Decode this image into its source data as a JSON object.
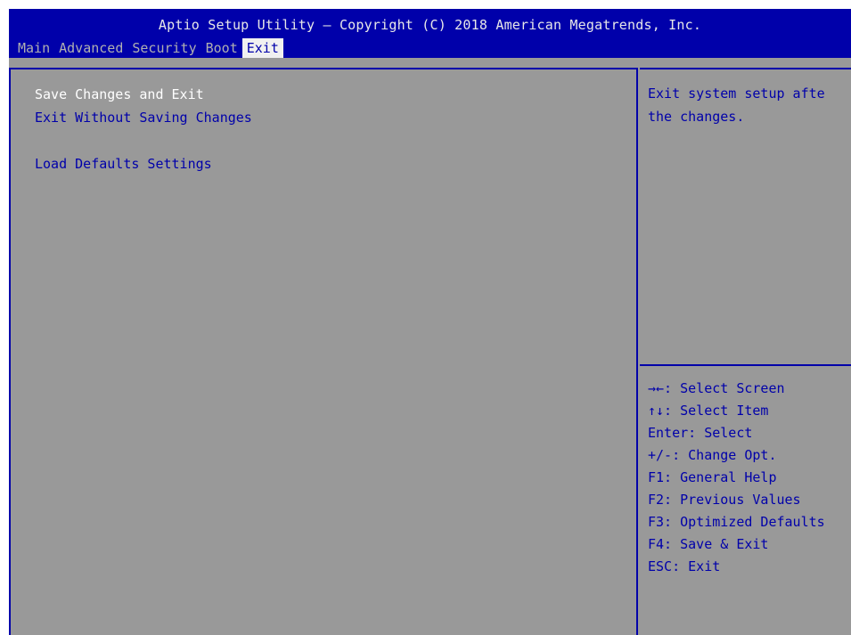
{
  "header": {
    "title": "Aptio Setup Utility – Copyright (C) 2018 American Megatrends, Inc.",
    "tabs": [
      {
        "label": "Main",
        "selected": false
      },
      {
        "label": "Advanced",
        "selected": false
      },
      {
        "label": "Security",
        "selected": false
      },
      {
        "label": "Boot",
        "selected": false
      },
      {
        "label": "Exit",
        "selected": true
      }
    ]
  },
  "menu": {
    "items": [
      {
        "label": "Save Changes and Exit",
        "selected": true
      },
      {
        "label": "Exit Without Saving Changes",
        "selected": false
      },
      {
        "label": "Load Defaults Settings",
        "selected": false
      }
    ]
  },
  "help": {
    "lines": [
      "Exit system setup afte",
      "the changes."
    ]
  },
  "keys": [
    "→←: Select Screen",
    "↑↓: Select Item",
    "Enter: Select",
    "+/-: Change Opt.",
    "F1: General Help",
    "F2: Previous Values",
    "F3: Optimized Defaults",
    "F4: Save & Exit",
    "ESC: Exit"
  ],
  "colors": {
    "header_bg": "#0000aa",
    "content_bg": "#999999",
    "text_blue": "#0000aa",
    "selected_text": "#ffffff",
    "tab_inactive": "#b0b0b0",
    "tab_active_bg": "#f0f0f0"
  }
}
